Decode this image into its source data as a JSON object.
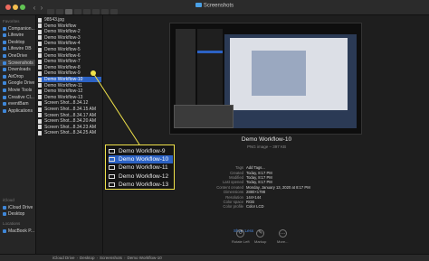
{
  "window": {
    "title": "Screenshots"
  },
  "sidebar": {
    "sections": [
      {
        "label": "Favorites",
        "items": [
          "Companion...",
          "Lifewire",
          "Desktop",
          "Lifewire DB",
          "OneDrive",
          "Screenshots",
          "Downloads",
          "AirDrop",
          "Google Drive",
          "Movie Tools",
          "Creative Cl...",
          "eventBam",
          "Applications"
        ]
      },
      {
        "label": "iCloud",
        "items": [
          "iCloud Drive",
          "Desktop"
        ]
      },
      {
        "label": "Locations",
        "items": [
          "MacBook P..."
        ]
      }
    ],
    "selected_item": "Screenshots"
  },
  "file_list": {
    "files": [
      "98543.jpg",
      "Demo Workflow",
      "Demo Workflow-2",
      "Demo Workflow-3",
      "Demo Workflow-4",
      "Demo Workflow-5",
      "Demo Workflow-6",
      "Demo Workflow-7",
      "Demo Workflow-8",
      "Demo Workflow-9",
      "Demo Workflow-10",
      "Demo Workflow-11",
      "Demo Workflow-12",
      "Demo Workflow-13",
      "Screen Shot...8.34.12",
      "Screen Shot...8.34.15 AM",
      "Screen Shot...8.34.17 AM",
      "Screen Shot...8.34.20 AM",
      "Screen Shot...8.34.23 AM",
      "Screen Shot...8.34.25 AM"
    ],
    "selected_index": 10
  },
  "preview": {
    "name": "Demo Workflow-10",
    "kind": "PNG image – 397 KB",
    "info": [
      {
        "key": "Tags",
        "value": "Add Tags..."
      },
      {
        "key": "Created",
        "value": "Today, 8:17 PM"
      },
      {
        "key": "Modified",
        "value": "Today, 8:17 PM"
      },
      {
        "key": "Last opened",
        "value": "Today, 8:17 PM"
      },
      {
        "key": "Content created",
        "value": "Monday, January 13, 2020 at 8:17 PM"
      },
      {
        "key": "Dimensions",
        "value": "2880×1798"
      },
      {
        "key": "Resolution",
        "value": "144×144"
      },
      {
        "key": "Color space",
        "value": "RGB"
      },
      {
        "key": "Color profile",
        "value": "Color LCD"
      }
    ],
    "show_less": "Show Less",
    "actions": [
      {
        "label": "Rotate Left",
        "icon": "rotate-left-icon",
        "glyph": "↺"
      },
      {
        "label": "Markup",
        "icon": "markup-icon",
        "glyph": "✎"
      },
      {
        "label": "More...",
        "icon": "more-icon",
        "glyph": "…"
      }
    ]
  },
  "path_bar": [
    "iCloud Drive",
    "Desktop",
    "Screenshots",
    "Demo Workflow-10"
  ],
  "callout": {
    "items": [
      "Demo Workflow-9",
      "Demo Workflow-10",
      "Demo Workflow-11",
      "Demo Workflow-12",
      "Demo Workflow-13"
    ],
    "selected_index": 1,
    "accent": "#f0e24a"
  },
  "colors": {
    "selection": "#2c62c4",
    "folder": "#4aa0e6",
    "link": "#4c8ee8"
  }
}
